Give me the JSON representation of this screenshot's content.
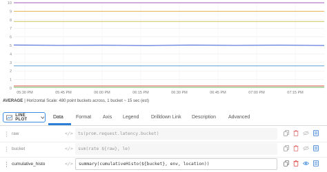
{
  "chart_data": {
    "type": "line",
    "title": "",
    "xlabel": "",
    "ylabel": "",
    "x_ticks": [
      "05:30 PM",
      "05:45 PM",
      "06:00 PM",
      "06:15 PM",
      "06:30 PM",
      "06:45 PM",
      "07:00 PM",
      "07:15 PM"
    ],
    "y_ticks": [
      0,
      1,
      2,
      3,
      4,
      5,
      6,
      7,
      8,
      9,
      10
    ],
    "ylim": [
      0,
      10
    ],
    "grid": true,
    "series": [
      {
        "color": "#a15ab8",
        "values": [
          10,
          10,
          10,
          10,
          10,
          10,
          10,
          10
        ]
      },
      {
        "color": "#e9b14d",
        "values": [
          9,
          9,
          9,
          9,
          9,
          9,
          9,
          9
        ]
      },
      {
        "color": "#c9c45a",
        "values": [
          7.8,
          7.8,
          7.8,
          7.8,
          7.8,
          7.8,
          7.8,
          7.8
        ]
      },
      {
        "color": "#3b5bd6",
        "values": [
          5.05,
          5.0,
          5.02,
          4.98,
          5.04,
          5.0,
          5.03,
          4.99
        ]
      },
      {
        "color": "#5aa0d8",
        "values": [
          2.6,
          2.6,
          2.6,
          2.6,
          2.6,
          2.6,
          2.6,
          2.6
        ]
      },
      {
        "color": "#e05a5a",
        "values": [
          0.25,
          0.25,
          0.25,
          0.25,
          0.25,
          0.25,
          0.25,
          0.25
        ]
      },
      {
        "color": "#6cbf5a",
        "values": [
          0.1,
          0.1,
          0.1,
          0.1,
          0.1,
          0.1,
          0.1,
          0.1
        ]
      }
    ]
  },
  "info": {
    "label": "AVERAGE",
    "text": "| Horizontal Scale: 480 point buckets across, 1 bucket ~ 15 sec (est)"
  },
  "plot_type": {
    "label": "LINE PLOT",
    "icon": "line-chart-icon"
  },
  "tabs": [
    "Data",
    "Format",
    "Axis",
    "Legend",
    "Drilldown Link",
    "Description",
    "Advanced"
  ],
  "queries": [
    {
      "name": "raw",
      "query": "ts(prom.request.latency.bucket)"
    },
    {
      "name": "bucket",
      "query": "sum(rate ${raw}, le)"
    },
    {
      "name": "cumulative_histo",
      "query": "summary(cumulativeHisto(${bucket}, env, location))"
    }
  ],
  "colors": {
    "accent": "#2b7fd6"
  }
}
